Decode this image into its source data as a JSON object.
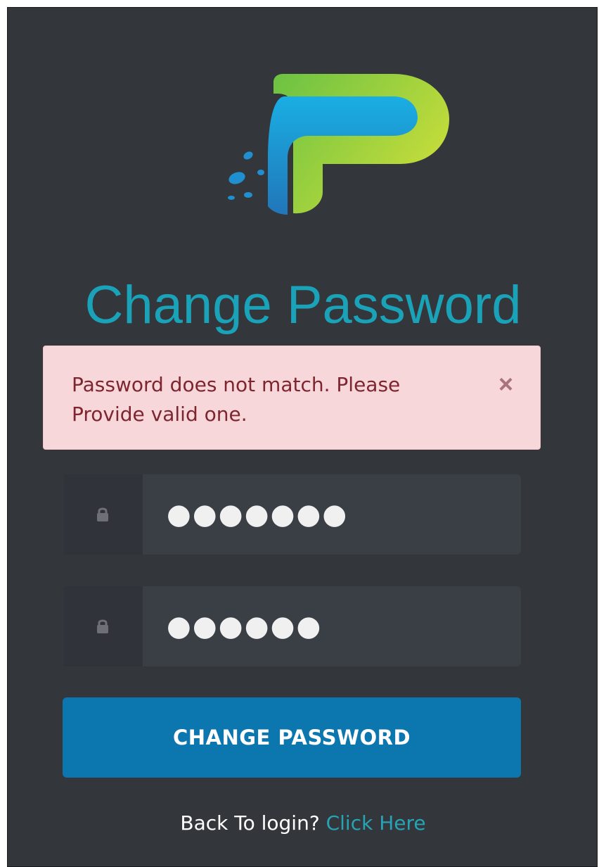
{
  "page": {
    "title": "Change Password"
  },
  "alert": {
    "message": "Password does not match. Please Provide valid one.",
    "close_symbol": "×",
    "icon": "close-icon"
  },
  "form": {
    "fields": [
      {
        "name": "password",
        "value": "●●●●●●●",
        "icon": "lock-icon"
      },
      {
        "name": "confirm-password",
        "value": "●●●●●●",
        "icon": "lock-icon"
      }
    ],
    "submit_label": "CHANGE PASSWORD"
  },
  "footer": {
    "prompt": "Back To login?",
    "link_label": "Click Here"
  },
  "colors": {
    "background": "#33363b",
    "title": "#1aa2b8",
    "alert_bg": "#f8d7da",
    "alert_text": "#7d2630",
    "button": "#0c76ae",
    "link": "#27a3b6"
  }
}
